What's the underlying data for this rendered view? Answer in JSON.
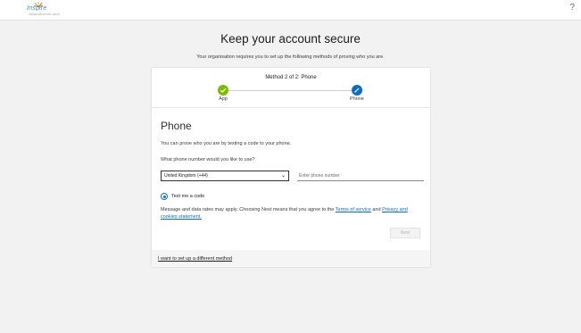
{
  "header": {
    "logo_text": "Inspire",
    "logo_subtext": "INSPIRE EDUCATION GROUP",
    "help_label": "?"
  },
  "page": {
    "title": "Keep your account secure",
    "subtitle": "Your organisation requires you to set up the following methods of proving who you are."
  },
  "wizard": {
    "method_label": "Method 2 of 2: Phone",
    "steps": [
      {
        "label": "App",
        "status": "complete",
        "color": "#7cbb00",
        "icon": "check-icon"
      },
      {
        "label": "Phone",
        "status": "current",
        "color": "#0f6cbd",
        "icon": "pencil-icon"
      }
    ]
  },
  "phone_section": {
    "title": "Phone",
    "description": "You can prove who you are by texting a code to your phone.",
    "question": "What phone number would you like to use?",
    "country_select": {
      "value": "United Kingdom (+44)"
    },
    "phone_input": {
      "placeholder": "Enter phone number",
      "value": ""
    },
    "radio_option": {
      "label": "Text me a code",
      "selected": true
    },
    "disclaimer_prefix": "Message and data rates may apply. Choosing Next means that you agree to the ",
    "terms_link": "Terms of service",
    "disclaimer_and": " and ",
    "privacy_link": "Privacy and cookies statement.",
    "next_button": "Next"
  },
  "footer": {
    "alt_method_link": "I want to set up a different method"
  },
  "colors": {
    "accent": "#0f6cbd",
    "complete": "#7cbb00",
    "background": "#f2f2f2"
  }
}
